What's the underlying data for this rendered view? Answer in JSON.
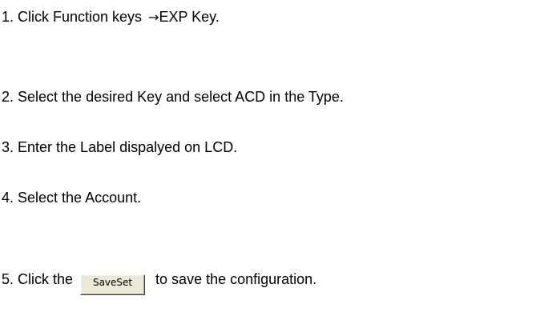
{
  "steps": [
    {
      "prefix": "1. Click Function keys",
      "arrow": "→",
      "suffix": "EXP Key."
    },
    {
      "text": "2. Select the desired Key and select ACD in the Type."
    },
    {
      "text": "3. Enter the Label dispalyed on LCD."
    },
    {
      "text": "4. Select the Account."
    },
    {
      "prefix": "5. Click the",
      "button_label": "SaveSet",
      "suffix": "to save the configuration."
    }
  ]
}
